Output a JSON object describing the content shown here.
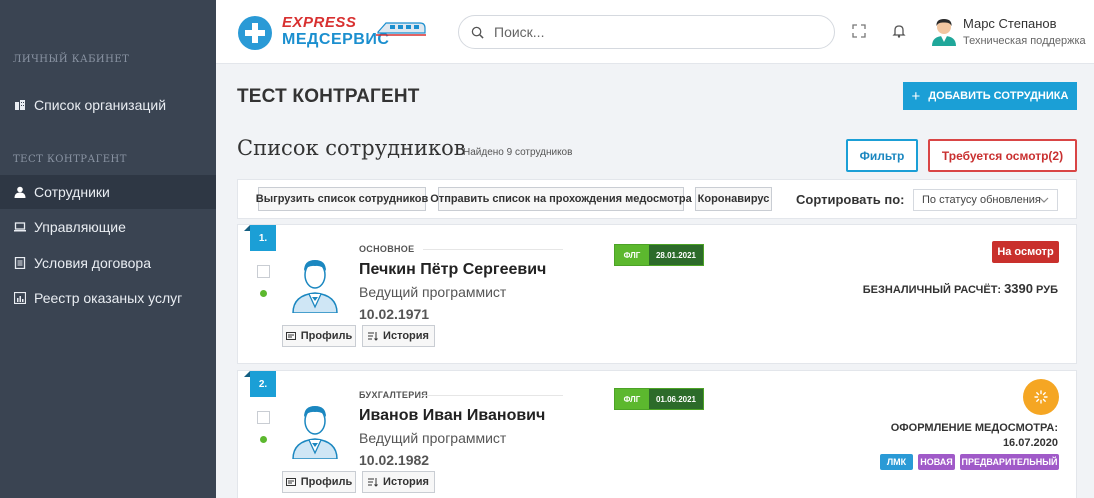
{
  "sidebar": {
    "section1": "ЛИЧНЫЙ КАБИНЕТ",
    "item_orgs": "Список организаций",
    "section2": "ТЕСТ КОНТРАГЕНТ",
    "items": [
      {
        "label": "Сотрудники",
        "icon": "user-icon"
      },
      {
        "label": "Управляющие",
        "icon": "laptop-icon"
      },
      {
        "label": "Условия договора",
        "icon": "document-icon"
      },
      {
        "label": "Реестр оказаных услуг",
        "icon": "chart-icon"
      }
    ]
  },
  "header": {
    "logo_express": "EXPRESS",
    "logo_med": "МЕДСЕРВИС",
    "search_placeholder": "Поиск...",
    "user_name": "Марс Степанов",
    "user_role": "Техническая поддержка"
  },
  "main": {
    "title": "ТЕСТ КОНТРАГЕНТ",
    "add_button": "ДОБАВИТЬ СОТРУДНИКА",
    "list_title": "Список сотрудников",
    "found": "Найдено 9 сотрудников",
    "filter_button": "Фильтр",
    "required_button": "Требуется осмотр(2)",
    "toolbar": {
      "export": "Выгрузить список сотрудников",
      "send": "Отправить список на прохождения медосмотра",
      "covid": "Коронавирус",
      "sort_label": "Сортировать по:",
      "sort_value": "По статусу обновления"
    },
    "employees": [
      {
        "num": "1.",
        "dept": "ОСНОВНОЕ",
        "name": "Печкин Пётр Сергеевич",
        "position": "Ведущий программист",
        "dob": "10.02.1971",
        "flg_label": "ФЛГ",
        "flg_date": "28.01.2021",
        "status": "На осмотр",
        "payment_label": "БЕЗНАЛИЧНЫЙ РАСЧЁТ:",
        "payment_amount": "3390",
        "payment_currency": "РУБ",
        "profile": "Профиль",
        "history": "История"
      },
      {
        "num": "2.",
        "dept": "БУХГАЛТЕРИЯ",
        "name": "Иванов Иван Иванович",
        "position": "Ведущий программист",
        "dob": "10.02.1982",
        "flg_label": "ФЛГ",
        "flg_date": "01.06.2021",
        "process_label": "ОФОРМЛЕНИЕ МЕДОСМОТРА:",
        "process_date": "16.07.2020",
        "tags": [
          "ЛМК",
          "НОВАЯ",
          "ПРЕДВАРИТЕЛЬНЫЙ"
        ],
        "profile": "Профиль",
        "history": "История"
      }
    ]
  },
  "colors": {
    "sidebar_bg": "#3a4452",
    "accent": "#1b9fd6",
    "danger": "#c9302c",
    "flg_green": "#5cb82e",
    "pending": "#f5a623",
    "tag_blue": "#2a9ad6",
    "tag_purple": "#a05ac8"
  }
}
